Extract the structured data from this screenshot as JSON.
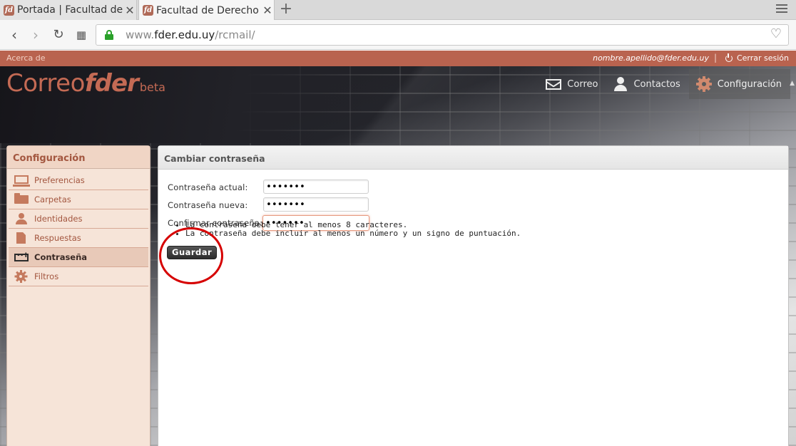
{
  "browser": {
    "tabs": [
      {
        "title": "Portada | Facultad de",
        "favicon": "fd"
      },
      {
        "title": "Facultad de Derecho",
        "favicon": "fd",
        "active": true
      }
    ],
    "new_tab": "+",
    "url": {
      "prefix": "www.",
      "domain": "fder.edu.uy",
      "path": "/rcmail/"
    },
    "icons": [
      "back-icon",
      "forward-icon",
      "reload-icon",
      "speed-dial-icon",
      "lock-icon",
      "heart-icon",
      "tab-menu-icon"
    ]
  },
  "app": {
    "topbar": {
      "about": "Acerca de",
      "user": "nombre.apellido@fder.edu.uy",
      "separator": "|",
      "logout": "Cerrar sesión"
    },
    "logo": {
      "part1": "Correo",
      "part2": "fder",
      "part3": "beta"
    },
    "taskbar": [
      {
        "label": "Correo",
        "icon": "mail-icon"
      },
      {
        "label": "Contactos",
        "icon": "person-icon"
      },
      {
        "label": "Configuración",
        "icon": "gear-icon",
        "selected": true
      }
    ],
    "settings_nav": {
      "title": "Configuración",
      "items": [
        {
          "label": "Preferencias",
          "icon": "monitor-icon"
        },
        {
          "label": "Carpetas",
          "icon": "folder-icon"
        },
        {
          "label": "Identidades",
          "icon": "person-icon"
        },
        {
          "label": "Respuestas",
          "icon": "document-icon"
        },
        {
          "label": "Contraseña",
          "icon": "password-icon",
          "selected": true
        },
        {
          "label": "Filtros",
          "icon": "gear-icon"
        }
      ]
    },
    "content": {
      "title": "Cambiar contraseña",
      "fields": [
        {
          "label": "Contraseña actual:",
          "value": "•••••••"
        },
        {
          "label": "Contraseña nueva:",
          "value": "•••••••"
        },
        {
          "label": "Confirmar contraseña:",
          "value": "•••••••",
          "focused": true
        }
      ],
      "rules": [
        "La contraseña debe tener al menos 8 caracteres.",
        "La contraseña debe incluir al menos un número y un signo de puntuación."
      ],
      "save_label": "Guardar"
    },
    "colors": {
      "accent": "#b9634f",
      "logo": "#c46a54",
      "highlight_circle": "#d60000"
    }
  }
}
